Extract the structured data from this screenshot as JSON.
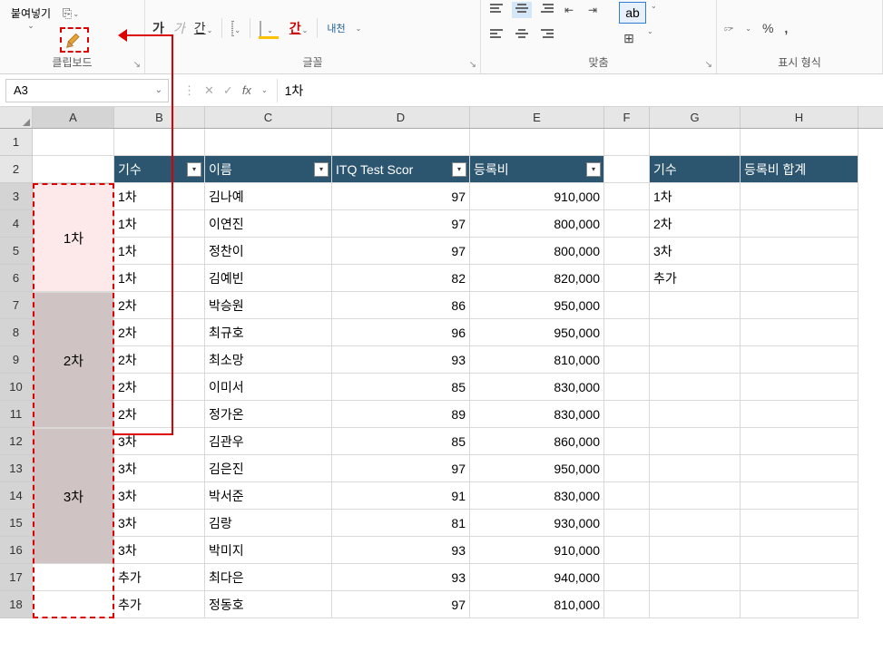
{
  "ribbon": {
    "clipboard": {
      "label": "클립보드",
      "paste": "붙여넣기",
      "copy_icon": "⎘"
    },
    "font": {
      "label": "글꼴",
      "bold": "가",
      "italic": "가",
      "underline": "간",
      "fontcolor": "간",
      "ruby": "내천"
    },
    "align": {
      "label": "맞춤"
    },
    "numfmt": {
      "label": "표시 형식",
      "currency": "%",
      "comma": ","
    }
  },
  "namebox": "A3",
  "formula": "1차",
  "columns": [
    "A",
    "B",
    "C",
    "D",
    "E",
    "F",
    "G",
    "H"
  ],
  "table1": {
    "headers": {
      "b": "기수",
      "c": "이름",
      "d": "ITQ Test Scor",
      "e": "등록비"
    },
    "rows": [
      {
        "b": "1차",
        "c": "김나예",
        "d": "97",
        "e": "910,000"
      },
      {
        "b": "1차",
        "c": "이연진",
        "d": "97",
        "e": "800,000"
      },
      {
        "b": "1차",
        "c": "정찬이",
        "d": "97",
        "e": "800,000"
      },
      {
        "b": "1차",
        "c": "김예빈",
        "d": "82",
        "e": "820,000"
      },
      {
        "b": "2차",
        "c": "박승원",
        "d": "86",
        "e": "950,000"
      },
      {
        "b": "2차",
        "c": "최규호",
        "d": "96",
        "e": "950,000"
      },
      {
        "b": "2차",
        "c": "최소망",
        "d": "93",
        "e": "810,000"
      },
      {
        "b": "2차",
        "c": "이미서",
        "d": "85",
        "e": "830,000"
      },
      {
        "b": "2차",
        "c": "정가온",
        "d": "89",
        "e": "830,000"
      },
      {
        "b": "3차",
        "c": "김관우",
        "d": "85",
        "e": "860,000"
      },
      {
        "b": "3차",
        "c": "김은진",
        "d": "97",
        "e": "950,000"
      },
      {
        "b": "3차",
        "c": "박서준",
        "d": "91",
        "e": "830,000"
      },
      {
        "b": "3차",
        "c": "김랑",
        "d": "81",
        "e": "930,000"
      },
      {
        "b": "3차",
        "c": "박미지",
        "d": "93",
        "e": "910,000"
      },
      {
        "b": "추가",
        "c": "최다은",
        "d": "93",
        "e": "940,000"
      },
      {
        "b": "추가",
        "c": "정동호",
        "d": "97",
        "e": "810,000"
      }
    ]
  },
  "table2": {
    "headers": {
      "g": "기수",
      "h": "등록비 합계"
    },
    "rows": [
      "1차",
      "2차",
      "3차",
      "추가"
    ]
  },
  "merged": {
    "g1": "1차",
    "g2": "2차",
    "g3": "3차"
  }
}
